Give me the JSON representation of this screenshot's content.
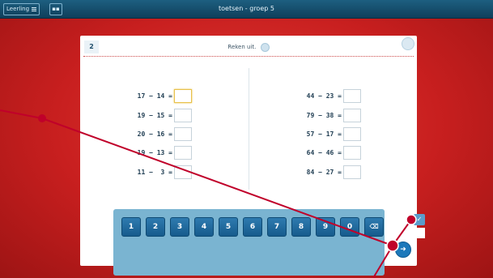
{
  "topbar": {
    "user_label": "Leerling",
    "menu_icon": "menu-icon",
    "grid_icon": "grid-icon",
    "title": "toetsen - groep 5"
  },
  "question": {
    "number": "2",
    "instruction": "Reken uit.",
    "left": [
      {
        "expr": "17 − 14 ="
      },
      {
        "expr": "19 − 15 ="
      },
      {
        "expr": "20 − 16 ="
      },
      {
        "expr": "19 − 13 ="
      },
      {
        "expr": "11 −  3 ="
      }
    ],
    "right": [
      {
        "expr": "44 − 23 ="
      },
      {
        "expr": "79 − 38 ="
      },
      {
        "expr": "57 − 17 ="
      },
      {
        "expr": "64 − 46 ="
      },
      {
        "expr": "84 − 27 ="
      }
    ]
  },
  "keypad": {
    "keys": [
      "1",
      "2",
      "3",
      "4",
      "5",
      "6",
      "7",
      "8",
      "9",
      "0"
    ],
    "delete_icon": "backspace-icon"
  },
  "controls": {
    "check_icon": "check-icon",
    "next_icon": "arrow-right-icon"
  },
  "colors": {
    "background": "#c81f1f",
    "topbar": "#154e6d",
    "key": "#1f6ea2",
    "keypad": "#7ab4d1",
    "annotation_line": "#c0002a"
  }
}
